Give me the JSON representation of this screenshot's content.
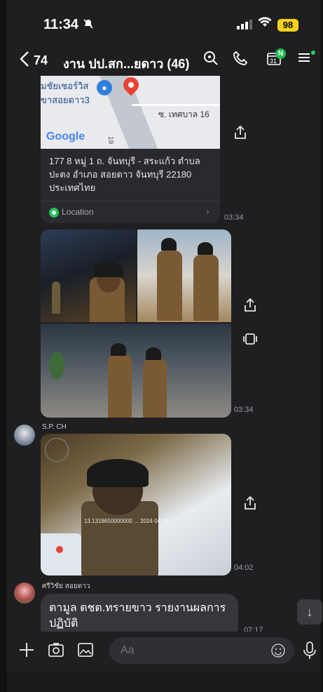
{
  "status_bar": {
    "time": "11:34",
    "battery": "98"
  },
  "header": {
    "back_count": "74",
    "title": "งาน ปป.สก...ยดาว (46)",
    "calendar_day": "31",
    "calendar_badge": "N"
  },
  "location_card": {
    "map_place_1": "มชัยเซอร์วิส",
    "map_place_2": "ขาสอยดาว3",
    "map_street": "ซ. เทศบาล 16",
    "map_number": "19",
    "map_provider": "Google",
    "address": "177 8 หมู่ 1 ถ. จันทบุรี - สระแก้ว ตำบล ปะตง อำเภอ สอยดาว จันทบุรี 22180 ประเทศไทย",
    "footer_label": "Location",
    "time": "03:34"
  },
  "photo_group": {
    "time": "03:34"
  },
  "photo_message": {
    "sender": "S.P. CH",
    "overlay": "13.1318650000000 ... 2024 04:02",
    "time": "04:02"
  },
  "text_message": {
    "sender": "ศรีวิชัย สอยดาว",
    "text": "ตามูล ตชต.ทรายขาว รายงานผลการปฏิบัติ",
    "time": "07:17"
  },
  "input": {
    "placeholder": "Aa"
  },
  "colors": {
    "background": "#1f1f22",
    "bubble": "#36363b",
    "accent_green": "#1fbe4e",
    "battery": "#f6d21d"
  },
  "icons": [
    "back-icon",
    "search-icon",
    "phone-icon",
    "calendar-icon",
    "menu-icon",
    "share-icon",
    "album-icon",
    "plus-icon",
    "camera-icon",
    "image-icon",
    "emoji-icon",
    "mic-icon",
    "arrow-down-icon"
  ]
}
